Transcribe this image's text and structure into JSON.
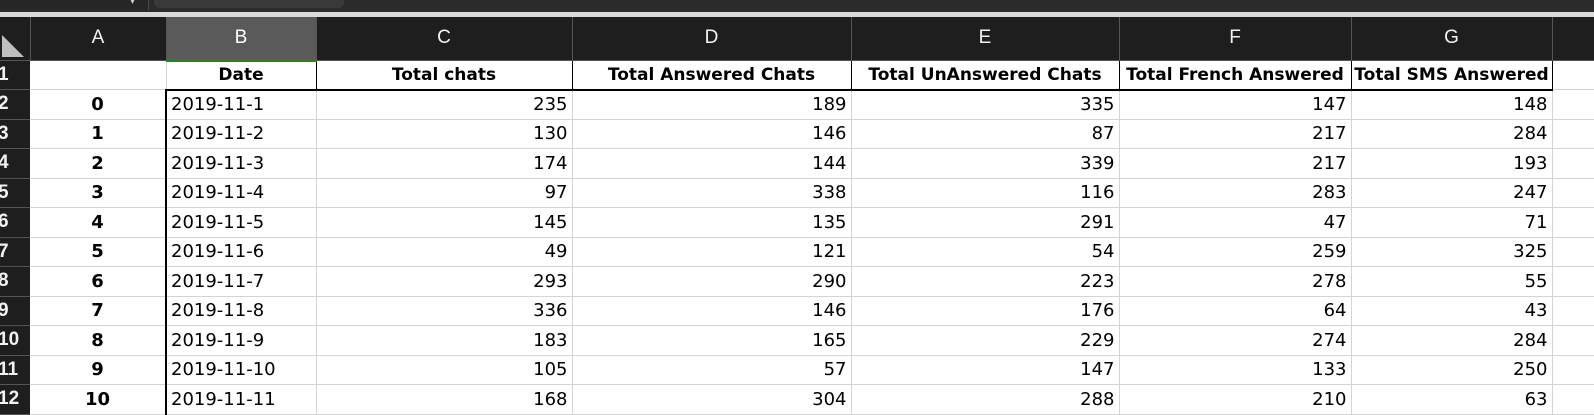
{
  "namebox_arrow": "▾",
  "columns": [
    "A",
    "B",
    "C",
    "D",
    "E",
    "F",
    "G",
    ""
  ],
  "selected_column": "B",
  "header_row": {
    "row_number": "1",
    "a": "",
    "date": "Date",
    "total_chats": "Total chats",
    "total_answered": "Total Answered Chats",
    "total_unanswered": "Total UnAnswered Chats",
    "total_french": "Total French Answered",
    "total_sms": "Total SMS Answered"
  },
  "rows": [
    {
      "row_number": "2",
      "idx": "0",
      "date": "2019-11-1",
      "total_chats": "235",
      "total_answered": "189",
      "total_unanswered": "335",
      "total_french": "147",
      "total_sms": "148"
    },
    {
      "row_number": "3",
      "idx": "1",
      "date": "2019-11-2",
      "total_chats": "130",
      "total_answered": "146",
      "total_unanswered": "87",
      "total_french": "217",
      "total_sms": "284"
    },
    {
      "row_number": "4",
      "idx": "2",
      "date": "2019-11-3",
      "total_chats": "174",
      "total_answered": "144",
      "total_unanswered": "339",
      "total_french": "217",
      "total_sms": "193"
    },
    {
      "row_number": "5",
      "idx": "3",
      "date": "2019-11-4",
      "total_chats": "97",
      "total_answered": "338",
      "total_unanswered": "116",
      "total_french": "283",
      "total_sms": "247"
    },
    {
      "row_number": "6",
      "idx": "4",
      "date": "2019-11-5",
      "total_chats": "145",
      "total_answered": "135",
      "total_unanswered": "291",
      "total_french": "47",
      "total_sms": "71"
    },
    {
      "row_number": "7",
      "idx": "5",
      "date": "2019-11-6",
      "total_chats": "49",
      "total_answered": "121",
      "total_unanswered": "54",
      "total_french": "259",
      "total_sms": "325"
    },
    {
      "row_number": "8",
      "idx": "6",
      "date": "2019-11-7",
      "total_chats": "293",
      "total_answered": "290",
      "total_unanswered": "223",
      "total_french": "278",
      "total_sms": "55"
    },
    {
      "row_number": "9",
      "idx": "7",
      "date": "2019-11-8",
      "total_chats": "336",
      "total_answered": "146",
      "total_unanswered": "176",
      "total_french": "64",
      "total_sms": "43"
    },
    {
      "row_number": "10",
      "idx": "8",
      "date": "2019-11-9",
      "total_chats": "183",
      "total_answered": "165",
      "total_unanswered": "229",
      "total_french": "274",
      "total_sms": "284"
    },
    {
      "row_number": "11",
      "idx": "9",
      "date": "2019-11-10",
      "total_chats": "105",
      "total_answered": "57",
      "total_unanswered": "147",
      "total_french": "133",
      "total_sms": "250"
    },
    {
      "row_number": "12",
      "idx": "10",
      "date": "2019-11-11",
      "total_chats": "168",
      "total_answered": "304",
      "total_unanswered": "288",
      "total_french": "210",
      "total_sms": "63"
    }
  ]
}
